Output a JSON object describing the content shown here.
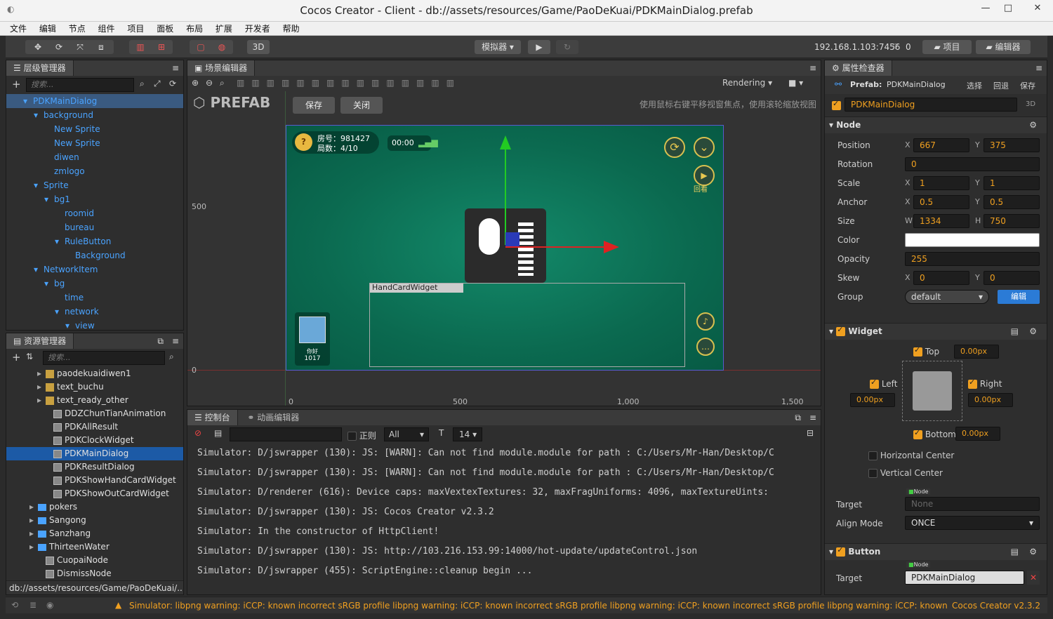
{
  "window": {
    "title": "Cocos Creator - Client - db://assets/resources/Game/PaoDeKuai/PDKMainDialog.prefab",
    "minimize": "—",
    "maximize": "□",
    "close": "✕"
  },
  "menu": [
    "文件",
    "编辑",
    "节点",
    "组件",
    "项目",
    "面板",
    "布局",
    "扩展",
    "开发者",
    "帮助"
  ],
  "toolbar": {
    "mode_3d": "3D",
    "simulator": "模拟器 ▾",
    "play": "▶",
    "refresh": "↻",
    "ip": "192.168.1.103:7456",
    "conn": "0",
    "project_btn": "项目",
    "editor_btn": "编辑器"
  },
  "hierarchy": {
    "title": "层级管理器",
    "search_placeholder": "搜索...",
    "items": [
      {
        "label": "PDKMainDialog",
        "indent": 0,
        "arrow": "▾"
      },
      {
        "label": "background",
        "indent": 1,
        "arrow": "▾"
      },
      {
        "label": "New Sprite",
        "indent": 2,
        "arrow": ""
      },
      {
        "label": "New Sprite",
        "indent": 2,
        "arrow": ""
      },
      {
        "label": "diwen",
        "indent": 2,
        "arrow": ""
      },
      {
        "label": "zmlogo",
        "indent": 2,
        "arrow": ""
      },
      {
        "label": "Sprite",
        "indent": 1,
        "arrow": "▾"
      },
      {
        "label": "bg1",
        "indent": 2,
        "arrow": "▾"
      },
      {
        "label": "roomid",
        "indent": 3,
        "arrow": ""
      },
      {
        "label": "bureau",
        "indent": 3,
        "arrow": ""
      },
      {
        "label": "RuleButton",
        "indent": 3,
        "arrow": "▾"
      },
      {
        "label": "Background",
        "indent": 4,
        "arrow": ""
      },
      {
        "label": "NetworkItem",
        "indent": 1,
        "arrow": "▾"
      },
      {
        "label": "bg",
        "indent": 2,
        "arrow": "▾"
      },
      {
        "label": "time",
        "indent": 3,
        "arrow": ""
      },
      {
        "label": "network",
        "indent": 3,
        "arrow": "▾"
      },
      {
        "label": "view",
        "indent": 4,
        "arrow": "▾"
      }
    ]
  },
  "assets": {
    "title": "资源管理器",
    "search_placeholder": "搜索...",
    "path": "db://assets/resources/Game/PaoDeKuai/...",
    "items": [
      {
        "label": "paodekuaidiwen1",
        "indent": 4,
        "arrow": "▸",
        "kind": "img"
      },
      {
        "label": "text_buchu",
        "indent": 4,
        "arrow": "▸",
        "kind": "img"
      },
      {
        "label": "text_ready_other",
        "indent": 4,
        "arrow": "▸",
        "kind": "img"
      },
      {
        "label": "DDZChunTianAnimation",
        "indent": 5,
        "arrow": "",
        "kind": "prefab"
      },
      {
        "label": "PDKAllResult",
        "indent": 5,
        "arrow": "",
        "kind": "prefab"
      },
      {
        "label": "PDKClockWidget",
        "indent": 5,
        "arrow": "",
        "kind": "prefab"
      },
      {
        "label": "PDKMainDialog",
        "indent": 5,
        "arrow": "",
        "kind": "prefab",
        "selected": true
      },
      {
        "label": "PDKResultDialog",
        "indent": 5,
        "arrow": "",
        "kind": "prefab"
      },
      {
        "label": "PDKShowHandCardWidget",
        "indent": 5,
        "arrow": "",
        "kind": "prefab"
      },
      {
        "label": "PDKShowOutCardWidget",
        "indent": 5,
        "arrow": "",
        "kind": "prefab"
      },
      {
        "label": "pokers",
        "indent": 3,
        "arrow": "▸",
        "kind": "folder"
      },
      {
        "label": "Sangong",
        "indent": 3,
        "arrow": "▸",
        "kind": "folder"
      },
      {
        "label": "Sanzhang",
        "indent": 3,
        "arrow": "▸",
        "kind": "folder"
      },
      {
        "label": "ThirteenWater",
        "indent": 3,
        "arrow": "▸",
        "kind": "folder"
      },
      {
        "label": "CuopaiNode",
        "indent": 4,
        "arrow": "",
        "kind": "prefab"
      },
      {
        "label": "DismissNode",
        "indent": 4,
        "arrow": "",
        "kind": "prefab"
      }
    ]
  },
  "scene": {
    "title": "场景编辑器",
    "prefab_label": "PREFAB",
    "save": "保存",
    "close": "关闭",
    "rendering": "Rendering",
    "hint": "使用鼠标右键平移视窗焦点，使用滚轮缩放视图",
    "ruler_y": [
      "500",
      "0"
    ],
    "ruler_x": [
      "0",
      "500",
      "1,000",
      "1,500"
    ],
    "room": "房号：981427",
    "rounds": "局数：4/10",
    "time": "00:00",
    "player_name": "你好",
    "player_score": "1017",
    "handcard": "HandCardWidget",
    "replay": "回看"
  },
  "console": {
    "title": "控制台",
    "tab2": "动画编辑器",
    "regex": "正则",
    "level": "All",
    "fontsize": "14",
    "lines": [
      "Simulator: D/jswrapper (130): JS: [WARN]: Can not find module.module for path : C:/Users/Mr-Han/Desktop/C",
      "Simulator: D/jswrapper (130): JS: [WARN]: Can not find module.module for path : C:/Users/Mr-Han/Desktop/C",
      "Simulator: D/renderer (616): Device caps: maxVextexTextures: 32, maxFragUniforms: 4096, maxTextureUints:",
      "Simulator: D/jswrapper (130): JS: Cocos Creator v2.3.2",
      "Simulator: In the constructor of HttpClient!",
      "Simulator: D/jswrapper (130): JS: http://103.216.153.99:14000/hot-update/updateControl.json",
      "Simulator: D/jswrapper (455): ScriptEngine::cleanup begin ..."
    ]
  },
  "inspector": {
    "title": "属性检查器",
    "prefab_label": "Prefab:",
    "prefab_name": "PDKMainDialog",
    "select": "选择",
    "revert": "回退",
    "save": "保存",
    "node_name": "PDKMainDialog",
    "mode_3d": "3D",
    "node_section": "Node",
    "position": {
      "label": "Position",
      "x": "667",
      "y": "375"
    },
    "rotation": {
      "label": "Rotation",
      "v": "0"
    },
    "scale": {
      "label": "Scale",
      "x": "1",
      "y": "1"
    },
    "anchor": {
      "label": "Anchor",
      "x": "0.5",
      "y": "0.5"
    },
    "size": {
      "label": "Size",
      "w": "1334",
      "h": "750"
    },
    "color": {
      "label": "Color",
      "value": "#ffffff"
    },
    "opacity": {
      "label": "Opacity",
      "v": "255"
    },
    "skew": {
      "label": "Skew",
      "x": "0",
      "y": "0"
    },
    "group": {
      "label": "Group",
      "v": "default",
      "edit": "编辑"
    },
    "widget_section": "Widget",
    "widget": {
      "top": "Top",
      "top_v": "0.00px",
      "left": "Left",
      "left_v": "0.00px",
      "right": "Right",
      "right_v": "0.00px",
      "bottom": "Bottom",
      "bottom_v": "0.00px",
      "hcenter": "Horizontal Center",
      "vcenter": "Vertical Center",
      "target": "Target",
      "target_tag": "Node",
      "target_v": "None",
      "align": "Align Mode",
      "align_v": "ONCE"
    },
    "button_section": "Button",
    "button": {
      "target": "Target",
      "target_tag": "Node",
      "target_v": "PDKMainDialog"
    }
  },
  "statusbar": {
    "warning": "Simulator: libpng warning: iCCP: known incorrect sRGB profile libpng warning: iCCP: known incorrect sRGB profile libpng warning: iCCP: known incorrect sRGB profile libpng warning: iCCP: known incorrect sRGB profile",
    "version": "Cocos Creator v2.3.2"
  },
  "colors": {
    "accent": "#f0a020",
    "tree": "#4aa3ff",
    "select": "#1c5aa6",
    "felt": "#0f6e56"
  }
}
